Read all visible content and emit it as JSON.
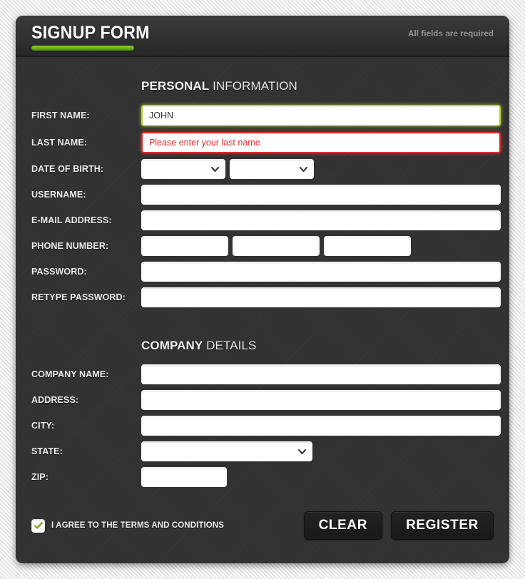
{
  "header": {
    "title": "SIGNUP FORM",
    "required_note": "All fields are required"
  },
  "sections": {
    "personal": {
      "strong": "PERSONAL",
      "light": "INFORMATION"
    },
    "company": {
      "strong": "COMPANY",
      "light": "DETAILS"
    }
  },
  "fields": {
    "first_name": {
      "label": "FIRST NAME:",
      "value": "JOHN",
      "placeholder": "",
      "state": "valid",
      "marker": "check-icon"
    },
    "last_name": {
      "label": "LAST NAME:",
      "value": "",
      "placeholder": "Please enter your last name",
      "state": "error",
      "marker": "error-square-icon"
    },
    "date_of_birth": {
      "label": "DATE OF BIRTH:",
      "day_value": "",
      "month_value": "",
      "day_options": [
        ""
      ],
      "month_options": [
        ""
      ]
    },
    "username": {
      "label": "USERNAME:",
      "value": "",
      "placeholder": ""
    },
    "email": {
      "label": "E-MAIL ADDRESS:",
      "value": "",
      "placeholder": ""
    },
    "phone": {
      "label": "PHONE NUMBER:",
      "part1": "",
      "part2": "",
      "part3": "",
      "placeholder": ""
    },
    "password": {
      "label": "PASSWORD:",
      "value": "",
      "placeholder": ""
    },
    "retype_password": {
      "label": "RETYPE PASSWORD:",
      "value": "",
      "placeholder": ""
    },
    "company_name": {
      "label": "COMPANY NAME:",
      "value": "",
      "placeholder": ""
    },
    "address": {
      "label": "ADDRESS:",
      "value": "",
      "placeholder": ""
    },
    "city": {
      "label": "CITY:",
      "value": "",
      "placeholder": ""
    },
    "state": {
      "label": "STATE:",
      "value": "",
      "options": [
        ""
      ]
    },
    "zip": {
      "label": "ZIP:",
      "value": "",
      "placeholder": ""
    }
  },
  "footer": {
    "agree_label": "I AGREE TO THE TERMS AND CONDITIONS",
    "agree_checked": true,
    "clear_label": "CLEAR",
    "register_label": "REGISTER"
  },
  "colors": {
    "panel": "#323232",
    "accent_green": "#6fb511",
    "valid_border": "#b9d531",
    "error_red": "#e02b2b",
    "button": "#1d1d1d",
    "page_bg": "#f2f2f2"
  }
}
